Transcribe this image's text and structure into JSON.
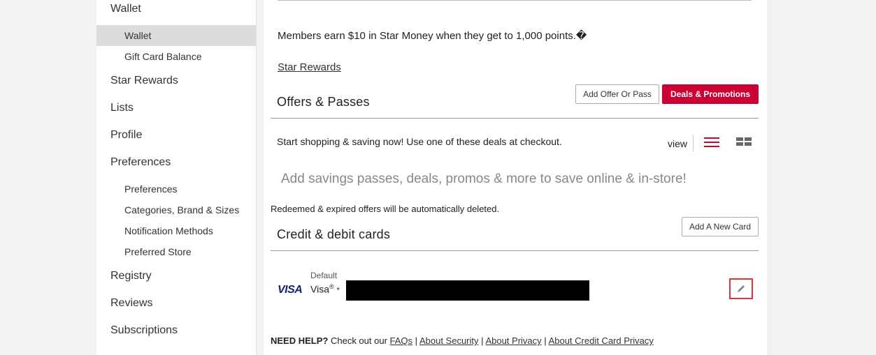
{
  "sidebar": {
    "wallet": "Wallet",
    "wallet_sub": "Wallet",
    "gift_card_balance": "Gift Card Balance",
    "star_rewards": "Star Rewards",
    "lists": "Lists",
    "profile": "Profile",
    "preferences": "Preferences",
    "preferences_sub": "Preferences",
    "categories_brand_sizes": "Categories, Brand & Sizes",
    "notification_methods": "Notification Methods",
    "preferred_store": "Preferred Store",
    "registry": "Registry",
    "reviews": "Reviews",
    "subscriptions": "Subscriptions"
  },
  "rewards": {
    "members_text": "Members earn $10 in Star Money when they get to 1,000 points.�",
    "star_rewards_link": "Star Rewards"
  },
  "offers": {
    "title": "Offers & Passes",
    "add_offer_button": "Add Offer Or Pass",
    "deals_button": "Deals & Promotions",
    "start_text": "Start shopping & saving now! Use one of these deals at checkout.",
    "view_label": "view",
    "empty_message": "Add savings passes, deals, promos & more to save online & in-store!",
    "redeemed_note": "Redeemed & expired offers will be automatically deleted."
  },
  "cards": {
    "title": "Credit & debit cards",
    "add_card_button": "Add A New Card",
    "default_label": "Default",
    "card_name": "Visa",
    "card_reg": "®",
    "card_mask": "*",
    "card_logo": "VISA"
  },
  "help": {
    "need_help": "NEED HELP?",
    "check_out": "Check out our",
    "faqs": "FAQs",
    "about_security": "About Security",
    "about_privacy": "About Privacy",
    "about_cc_privacy": "About Credit Card Privacy",
    "sep": "|"
  },
  "colors": {
    "accent": "#cc0033",
    "highlight_box": "#e0333a"
  }
}
